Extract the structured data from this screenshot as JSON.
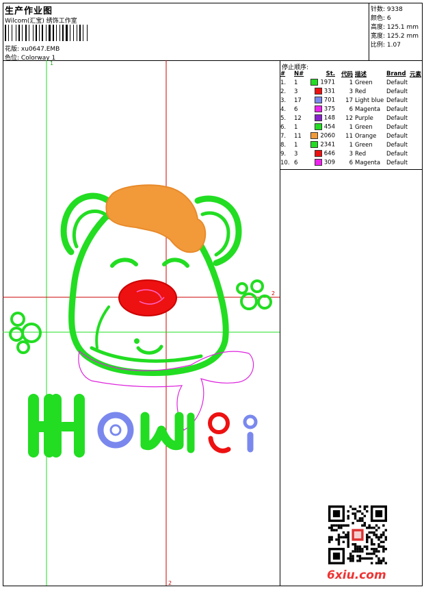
{
  "header": {
    "title": "生产作业图",
    "company": "Wilcom(汇宝) 绣饰工作室",
    "design_label": "花版:",
    "design_name": "xu0647.EMB",
    "colorway_label": "色位:",
    "colorway": "Colorway 1"
  },
  "stats": {
    "stitches": "针数: 9338",
    "colors": "颜色: 6",
    "height": "高度: 125.1 mm",
    "width": "宽度: 125.2 mm",
    "ratio": "比例: 1.07"
  },
  "legend": {
    "title": "停止顺序:",
    "headers": [
      "#",
      "N#",
      "St.",
      "代码",
      "描述",
      "Brand",
      "元素"
    ],
    "rows": [
      {
        "n": "1.",
        "code": "1",
        "st": "1971",
        "id": "1",
        "desc": "Green",
        "brand": "Default",
        "color": "#22dd22"
      },
      {
        "n": "2.",
        "code": "3",
        "st": "331",
        "id": "3",
        "desc": "Red",
        "brand": "Default",
        "color": "#ee1111"
      },
      {
        "n": "3.",
        "code": "17",
        "st": "701",
        "id": "17",
        "desc": "Light blue",
        "brand": "Default",
        "color": "#7a88ee"
      },
      {
        "n": "4.",
        "code": "6",
        "st": "375",
        "id": "6",
        "desc": "Magenta",
        "brand": "Default",
        "color": "#ee22ee"
      },
      {
        "n": "5.",
        "code": "12",
        "st": "148",
        "id": "12",
        "desc": "Purple",
        "brand": "Default",
        "color": "#8822cc"
      },
      {
        "n": "6.",
        "code": "1",
        "st": "454",
        "id": "1",
        "desc": "Green",
        "brand": "Default",
        "color": "#22dd22"
      },
      {
        "n": "7.",
        "code": "11",
        "st": "2060",
        "id": "11",
        "desc": "Orange",
        "brand": "Default",
        "color": "#f29a3a"
      },
      {
        "n": "8.",
        "code": "1",
        "st": "2341",
        "id": "1",
        "desc": "Green",
        "brand": "Default",
        "color": "#22dd22"
      },
      {
        "n": "9.",
        "code": "3",
        "st": "646",
        "id": "3",
        "desc": "Red",
        "brand": "Default",
        "color": "#ee1111"
      },
      {
        "n": "10.",
        "code": "6",
        "st": "309",
        "id": "6",
        "desc": "Magenta",
        "brand": "Default",
        "color": "#ee22ee"
      }
    ]
  },
  "guides": {
    "marker_1": "1",
    "marker_2": "2"
  },
  "watermark": "6xiu.com",
  "colors": {
    "green": "#22dd22",
    "orange": "#f29a3a",
    "red": "#ee1111",
    "lightblue": "#7a88ee",
    "magenta": "#dd22dd",
    "guide_red": "#cc0000"
  }
}
